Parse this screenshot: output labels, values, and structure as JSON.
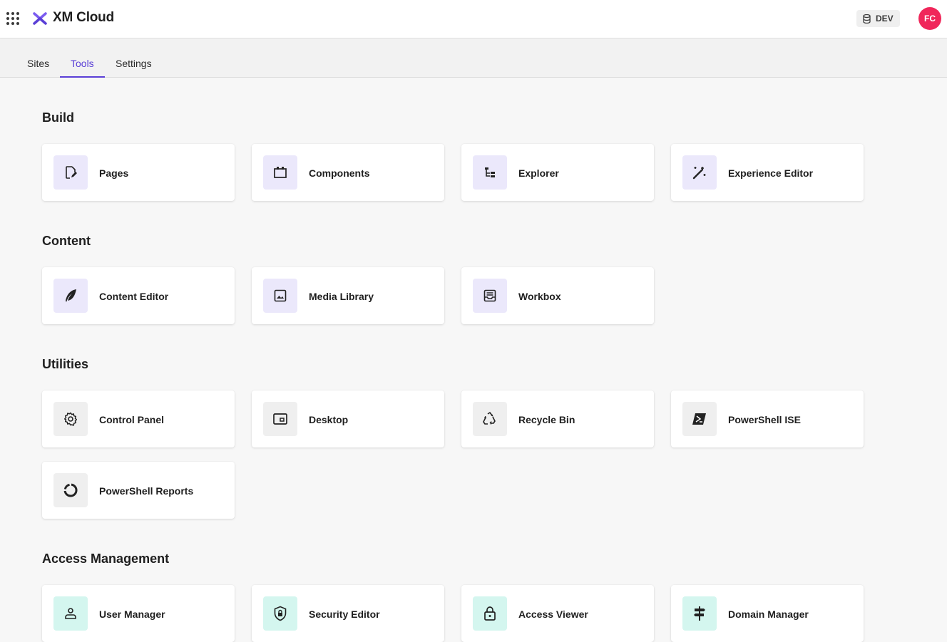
{
  "header": {
    "app_title": "XM Cloud",
    "environment": "DEV",
    "avatar_initials": "FC",
    "avatar_color": "#f0265a",
    "accent_color": "#5a3fd6"
  },
  "tabs": [
    {
      "label": "Sites",
      "active": false
    },
    {
      "label": "Tools",
      "active": true
    },
    {
      "label": "Settings",
      "active": false
    }
  ],
  "sections": {
    "build": {
      "title": "Build",
      "items": [
        {
          "label": "Pages",
          "icon": "page-edit-icon"
        },
        {
          "label": "Components",
          "icon": "components-icon"
        },
        {
          "label": "Explorer",
          "icon": "tree-icon"
        },
        {
          "label": "Experience Editor",
          "icon": "magic-wand-icon"
        }
      ]
    },
    "content": {
      "title": "Content",
      "items": [
        {
          "label": "Content Editor",
          "icon": "feather-icon"
        },
        {
          "label": "Media Library",
          "icon": "image-icon"
        },
        {
          "label": "Workbox",
          "icon": "inbox-icon"
        }
      ]
    },
    "utilities": {
      "title": "Utilities",
      "items": [
        {
          "label": "Control Panel",
          "icon": "gear-icon"
        },
        {
          "label": "Desktop",
          "icon": "desktop-icon"
        },
        {
          "label": "Recycle Bin",
          "icon": "recycle-icon"
        },
        {
          "label": "PowerShell ISE",
          "icon": "powershell-icon"
        },
        {
          "label": "PowerShell Reports",
          "icon": "donut-chart-icon"
        }
      ]
    },
    "access": {
      "title": "Access Management",
      "items": [
        {
          "label": "User Manager",
          "icon": "user-icon"
        },
        {
          "label": "Security Editor",
          "icon": "shield-lock-icon"
        },
        {
          "label": "Access Viewer",
          "icon": "lock-icon"
        },
        {
          "label": "Domain Manager",
          "icon": "signpost-icon"
        }
      ]
    }
  }
}
